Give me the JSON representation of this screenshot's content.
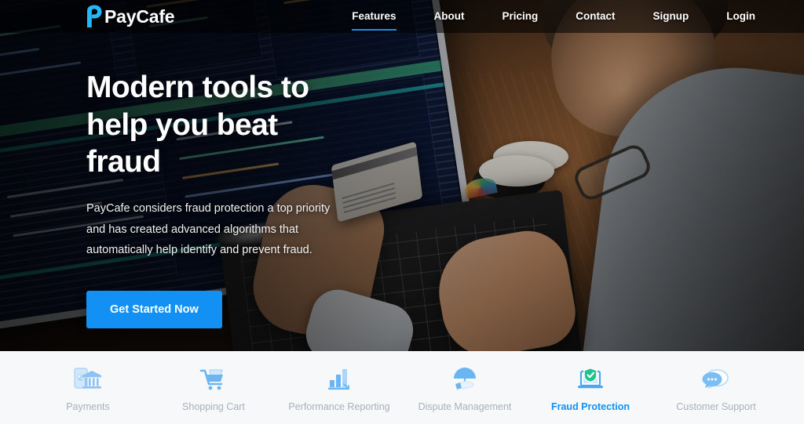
{
  "brand": {
    "name": "PayCafe",
    "mark_icon": "paycafe-p-logo-icon",
    "accent": "#29b6f6"
  },
  "nav": {
    "items": [
      {
        "label": "Features",
        "active": true
      },
      {
        "label": "About",
        "active": false
      },
      {
        "label": "Pricing",
        "active": false
      },
      {
        "label": "Contact",
        "active": false
      },
      {
        "label": "Signup",
        "active": false
      },
      {
        "label": "Login",
        "active": false
      }
    ],
    "active_underline_color": "#1a8fe8"
  },
  "hero": {
    "title": "Modern tools to help you beat fraud",
    "subtitle": "PayCafe considers fraud protection a top priority and has created advanced algorithms that automatically help identify and prevent fraud.",
    "cta_label": "Get Started Now",
    "cta_color": "#1390f4",
    "background_description": "Person at wooden desk holding a credit card while typing on a laptop, large monitor with code on the left"
  },
  "feature_bar": {
    "background": "#f7f8fa",
    "label_color": "#a8b0bd",
    "active_color": "#1390f4",
    "icon_color": "#9ecbf7",
    "items": [
      {
        "label": "Payments",
        "icon": "phone-bank-icon",
        "active": false
      },
      {
        "label": "Shopping Cart",
        "icon": "shopping-cart-icon",
        "active": false
      },
      {
        "label": "Performance Reporting",
        "icon": "bar-chart-icon",
        "active": false
      },
      {
        "label": "Dispute Management",
        "icon": "umbrella-hand-icon",
        "active": false
      },
      {
        "label": "Fraud Protection",
        "icon": "laptop-shield-check-icon",
        "active": true
      },
      {
        "label": "Customer Support",
        "icon": "chat-bubbles-icon",
        "active": false
      }
    ]
  }
}
